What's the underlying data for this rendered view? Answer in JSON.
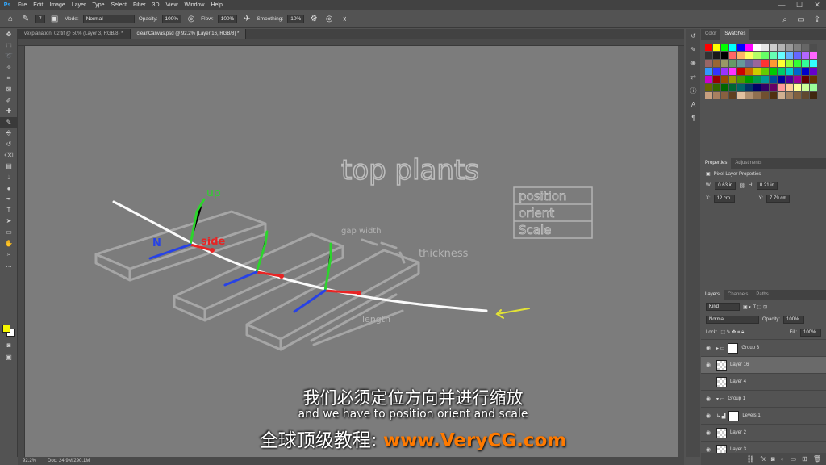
{
  "menu": {
    "logo": "Ps",
    "items": [
      "File",
      "Edit",
      "Image",
      "Layer",
      "Type",
      "Select",
      "Filter",
      "3D",
      "View",
      "Window",
      "Help"
    ],
    "window_controls": [
      "—",
      "☐",
      "✕"
    ]
  },
  "options": {
    "brush_size": "7",
    "mode_label": "Mode:",
    "mode_value": "Normal",
    "opacity_label": "Opacity:",
    "opacity_value": "100%",
    "flow_label": "Flow:",
    "flow_value": "100%",
    "smoothing_label": "Smoothing:",
    "smoothing_value": "10%"
  },
  "tabs": [
    "vexplanation_02.tif @ 50% (Layer 3, RGB/8) *",
    "cleanCanvas.psd @ 92.2% (Layer 16, RGB/8) *"
  ],
  "status": {
    "zoom": "92.2%",
    "doc": "Doc: 24.9M/290.1M"
  },
  "canvas": {
    "title": "top plants",
    "list": [
      "position",
      "orient",
      "Scale"
    ],
    "labels": {
      "up": "up",
      "side": "side",
      "n": "N",
      "gap_width": "gap width",
      "thickness": "thickness",
      "length": "length"
    }
  },
  "swatch_colors": [
    "#ff0000",
    "#ffff00",
    "#00ff00",
    "#00ffff",
    "#0000ff",
    "#ff00ff",
    "#ffffff",
    "#e6e6e6",
    "#cccccc",
    "#b3b3b3",
    "#999999",
    "#808080",
    "#666666",
    "#4d4d4d",
    "#333333",
    "#1a1a1a",
    "#000000",
    "#ff6666",
    "#ffb366",
    "#ffff66",
    "#b3ff66",
    "#66ff66",
    "#66ffb3",
    "#66ffff",
    "#66b3ff",
    "#6666ff",
    "#b366ff",
    "#ff66ff",
    "#996666",
    "#996633",
    "#999966",
    "#669966",
    "#669999",
    "#666699",
    "#996699",
    "#ff3333",
    "#ff9933",
    "#ffff33",
    "#99ff33",
    "#33ff33",
    "#33ff99",
    "#33ffff",
    "#3399ff",
    "#3333ff",
    "#9933ff",
    "#ff33ff",
    "#cc0000",
    "#cc6600",
    "#cccc00",
    "#66cc00",
    "#00cc00",
    "#00cc66",
    "#00cccc",
    "#0066cc",
    "#0000cc",
    "#6600cc",
    "#cc00cc",
    "#990000",
    "#994c00",
    "#999900",
    "#4c9900",
    "#009900",
    "#00994c",
    "#009999",
    "#004c99",
    "#000099",
    "#4c0099",
    "#990099",
    "#660000",
    "#663300",
    "#666600",
    "#336600",
    "#006600",
    "#006633",
    "#006666",
    "#003366",
    "#000066",
    "#330066",
    "#660066",
    "#ff9999",
    "#ffcc99",
    "#ffff99",
    "#ccff99",
    "#99ff99",
    "#c8a080",
    "#a88060",
    "#886040",
    "#604020",
    "#e0c0a0",
    "#b09070",
    "#907050",
    "#705030",
    "#503010",
    "#d0b090",
    "#a08060",
    "#806040",
    "#604830",
    "#402810"
  ],
  "panels": {
    "swatch_tabs": [
      "Color",
      "Swatches"
    ],
    "props_tabs": [
      "Properties",
      "Adjustments"
    ],
    "props_title": "Pixel Layer Properties",
    "w_label": "W:",
    "w_value": "0.63 in",
    "h_label": "H:",
    "h_value": "0.21 in",
    "x_label": "X:",
    "x_value": "12 cm",
    "y_label": "Y:",
    "y_value": "7.79 cm",
    "layers_tabs": [
      "Layers",
      "Channels",
      "Paths"
    ],
    "kind": "Kind",
    "blend": "Normal",
    "opacity_label": "Opacity:",
    "opacity_value": "100%",
    "lock_label": "Lock:",
    "fill_label": "Fill:",
    "fill_value": "100%",
    "layers": [
      {
        "name": "Group 3",
        "type": "group"
      },
      {
        "name": "Layer 16",
        "type": "layer",
        "selected": true
      },
      {
        "name": "Layer 4",
        "type": "layer"
      },
      {
        "name": "Group 1",
        "type": "group"
      },
      {
        "name": "Levels 1",
        "type": "adjust"
      },
      {
        "name": "Layer 2",
        "type": "layer"
      },
      {
        "name": "Layer 3",
        "type": "layer"
      }
    ]
  },
  "subtitles": {
    "cn": "我们必须定位方向并进行缩放",
    "en": "and we have to position orient and scale",
    "site_a": "全球顶级教程:",
    "site_b": "www.VeryCG.com"
  }
}
